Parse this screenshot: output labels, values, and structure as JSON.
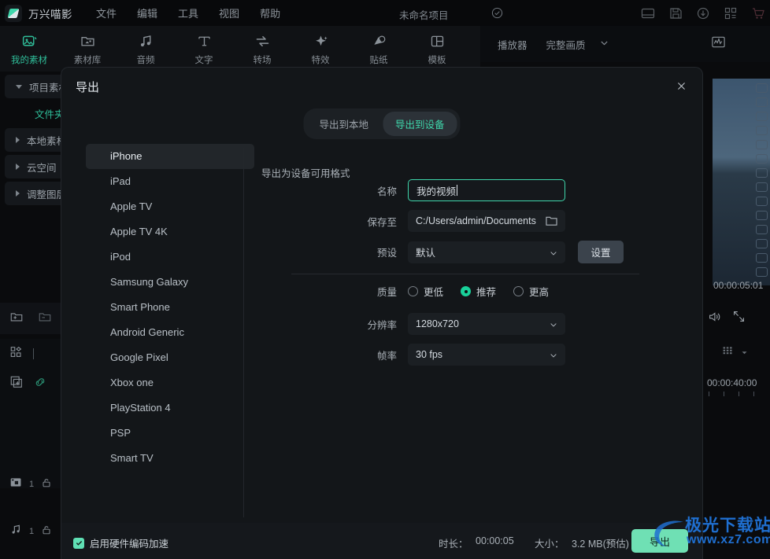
{
  "app": {
    "brand": "万兴喵影",
    "menu": [
      "文件",
      "编辑",
      "工具",
      "视图",
      "帮助"
    ],
    "project_title": "未命名项目"
  },
  "ribbon": {
    "tabs": [
      {
        "label": "我的素材",
        "icon": "image-icon",
        "active": true
      },
      {
        "label": "素材库",
        "icon": "folder-media-icon",
        "active": false
      },
      {
        "label": "音频",
        "icon": "music-note-icon",
        "active": false
      },
      {
        "label": "文字",
        "icon": "text-t-icon",
        "active": false
      },
      {
        "label": "转场",
        "icon": "transition-arrows-icon",
        "active": false
      },
      {
        "label": "特效",
        "icon": "sparkle-star-icon",
        "active": false
      },
      {
        "label": "贴纸",
        "icon": "sticker-icon",
        "active": false
      },
      {
        "label": "模板",
        "icon": "template-grid-icon",
        "active": false
      }
    ]
  },
  "player": {
    "label": "播放器",
    "quality": "完整画质"
  },
  "library": {
    "items": [
      {
        "label": "项目素材",
        "expanded": true,
        "accent": false
      },
      {
        "label": "文件夹",
        "expanded": false,
        "accent": true
      },
      {
        "label": "本地素材",
        "expanded": false,
        "accent": false
      },
      {
        "label": "云空间",
        "expanded": false,
        "accent": false
      },
      {
        "label": "调整图层",
        "expanded": false,
        "accent": false
      }
    ],
    "track_counts": [
      "1",
      "1"
    ]
  },
  "timeline": {
    "preview_timecode": "00:00:05:01",
    "ruler_timecode": "00:00:40:00"
  },
  "dialog": {
    "title": "导出",
    "close_icon": "close-icon",
    "tabs": [
      {
        "label": "导出到本地",
        "active": false
      },
      {
        "label": "导出到设备",
        "active": true
      }
    ],
    "devices": [
      {
        "label": "iPhone",
        "selected": true
      },
      {
        "label": "iPad",
        "selected": false
      },
      {
        "label": "Apple TV",
        "selected": false
      },
      {
        "label": "Apple TV 4K",
        "selected": false
      },
      {
        "label": "iPod",
        "selected": false
      },
      {
        "label": "Samsung Galaxy",
        "selected": false
      },
      {
        "label": "Smart Phone",
        "selected": false
      },
      {
        "label": "Android Generic",
        "selected": false
      },
      {
        "label": "Google Pixel",
        "selected": false
      },
      {
        "label": "Xbox one",
        "selected": false
      },
      {
        "label": "PlayStation 4",
        "selected": false
      },
      {
        "label": "PSP",
        "selected": false
      },
      {
        "label": "Smart TV",
        "selected": false
      }
    ],
    "format_note": "导出为设备可用格式",
    "fields": {
      "name_label": "名称",
      "name_value": "我的视频",
      "saveto_label": "保存至",
      "saveto_value": "C:/Users/admin/Documents",
      "preset_label": "预设",
      "preset_value": "默认",
      "settings_button": "设置",
      "quality_label": "质量",
      "quality_options": [
        {
          "label": "更低",
          "selected": false
        },
        {
          "label": "推荐",
          "selected": true
        },
        {
          "label": "更高",
          "selected": false
        }
      ],
      "resolution_label": "分辨率",
      "resolution_value": "1280x720",
      "framerate_label": "帧率",
      "framerate_value": "30 fps"
    },
    "footer": {
      "hwaccel_label": "启用硬件编码加速",
      "hwaccel_checked": true,
      "duration_label": "时长：",
      "duration_value": "00:00:05",
      "size_label": "大小：",
      "size_value": "3.2 MB(预估)",
      "export_button": "导出"
    }
  },
  "watermark": {
    "title": "极光下载站",
    "url": "www.xz7.com",
    "color": "#1f6fd0"
  },
  "colors": {
    "accent": "#3fd6ab",
    "dialog_bg": "#131619",
    "app_bg": "#0a0b0d"
  }
}
